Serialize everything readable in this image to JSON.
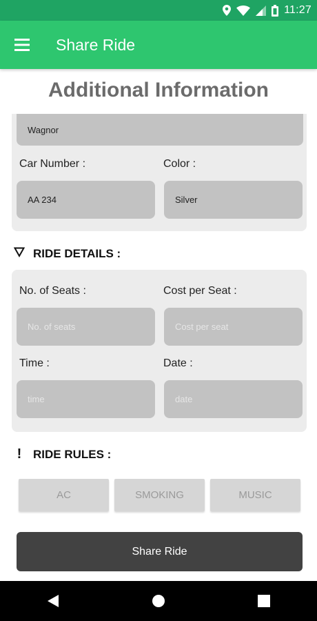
{
  "status_bar": {
    "time": "11:27",
    "icons": [
      "location-icon",
      "wifi-icon",
      "signal-icon",
      "battery-icon"
    ]
  },
  "app_bar": {
    "title": "Share Ride",
    "menu_icon": "hamburger-menu-icon"
  },
  "page": {
    "heading": "Additional Information"
  },
  "car_info": {
    "model_value": "Wagnor",
    "car_number_label": "Car Number :",
    "car_number_value": "AA 234",
    "color_label": "Color :",
    "color_value": "Silver"
  },
  "ride_details": {
    "section_title": "RIDE DETAILS :",
    "section_icon": "triangle-down-outline-icon",
    "seats_label": "No. of Seats :",
    "seats_placeholder": "No. of seats",
    "cost_label": "Cost per Seat :",
    "cost_placeholder": "Cost per seat",
    "time_label": "Time :",
    "time_placeholder": "time",
    "date_label": "Date :",
    "date_placeholder": "date"
  },
  "ride_rules": {
    "section_title": "RIDE RULES :",
    "section_icon": "exclamation-icon",
    "buttons": [
      "AC",
      "SMOKING",
      "MUSIC"
    ]
  },
  "actions": {
    "share_label": "Share Ride"
  },
  "nav_bar": {
    "icons": [
      "back-triangle-icon",
      "home-circle-icon",
      "recents-square-icon"
    ]
  },
  "colors": {
    "status_bar": "#1fa463",
    "app_bar": "#2ec66f",
    "card_bg": "#ececec",
    "field_bg": "#c2c2c2",
    "share_button": "#424242"
  }
}
